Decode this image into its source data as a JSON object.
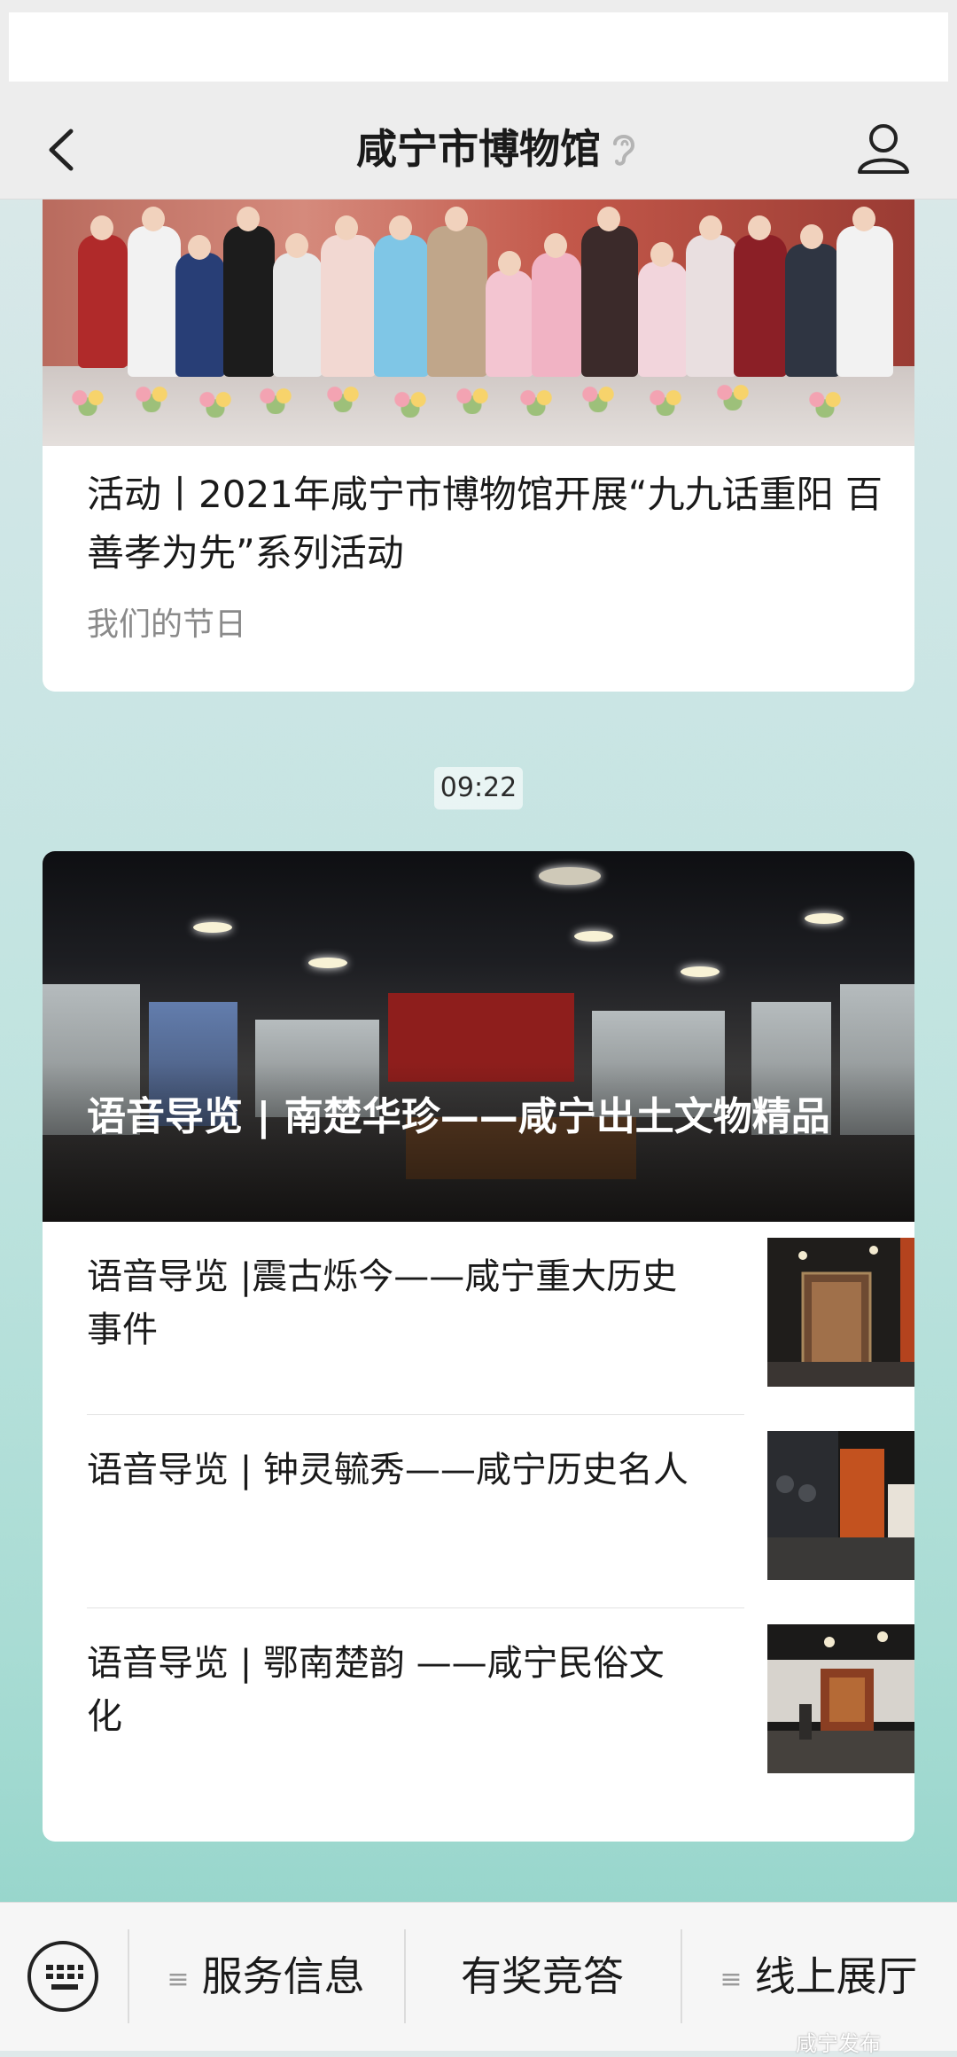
{
  "nav": {
    "title": "咸宁市博物馆"
  },
  "card1": {
    "title": "活动丨2021年咸宁市博物馆开展“九九话重阳 百善孝为先”系列活动",
    "subtitle": "我们的节日"
  },
  "time_label": "09:22",
  "card2": {
    "hero_title": "语音导览 | 南楚华珍——咸宁出土文物精品",
    "items": [
      {
        "title": "语音导览 |震古烁今——咸宁重大历史事件"
      },
      {
        "title": "语音导览 | 钟灵毓秀——咸宁历史名人"
      },
      {
        "title": "语音导览 | 鄂南楚韵 ——咸宁民俗文化"
      }
    ]
  },
  "bottom_menu": {
    "menu1": "服务信息",
    "menu2": "有奖竞答",
    "menu3": "线上展厅"
  },
  "watermark": "咸宁发布",
  "colors": {
    "nav_bg": "#ededed",
    "card_bg": "#ffffff",
    "hero_text": "#ffffff",
    "subtitle": "#8a8a8a"
  }
}
